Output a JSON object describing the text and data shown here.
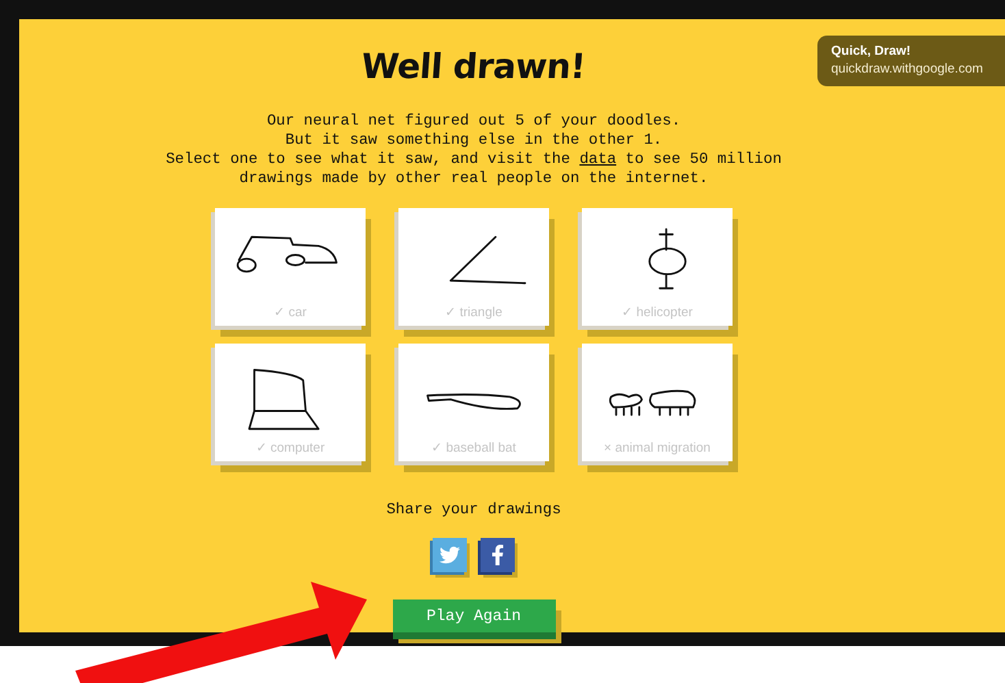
{
  "title": "Well drawn!",
  "message": {
    "lines": [
      "Our neural net figured out 5 of your doodles.",
      "But it saw something else in the other 1."
    ],
    "link_line": {
      "before": "Select one to see what it saw, and visit the",
      "link": "data",
      "after": "to see 50 million"
    },
    "last_line": "drawings made by other real people on the internet."
  },
  "cards": [
    {
      "kind": "car",
      "label": "✓ car"
    },
    {
      "kind": "triangle",
      "label": "✓ triangle"
    },
    {
      "kind": "helicopter",
      "label": "✓ helicopter"
    },
    {
      "kind": "computer",
      "label": "✓ computer"
    },
    {
      "kind": "bat",
      "label": "✓ baseball bat"
    },
    {
      "kind": "animals",
      "label": "× animal migration"
    }
  ],
  "share": {
    "label": "Share your drawings",
    "buttons": [
      {
        "kind": "twitter"
      },
      {
        "kind": "facebook"
      }
    ]
  },
  "play_button": "Play Again",
  "tooltip": {
    "title": "Quick, Draw!",
    "url": "quickdraw.withgoogle.com"
  }
}
